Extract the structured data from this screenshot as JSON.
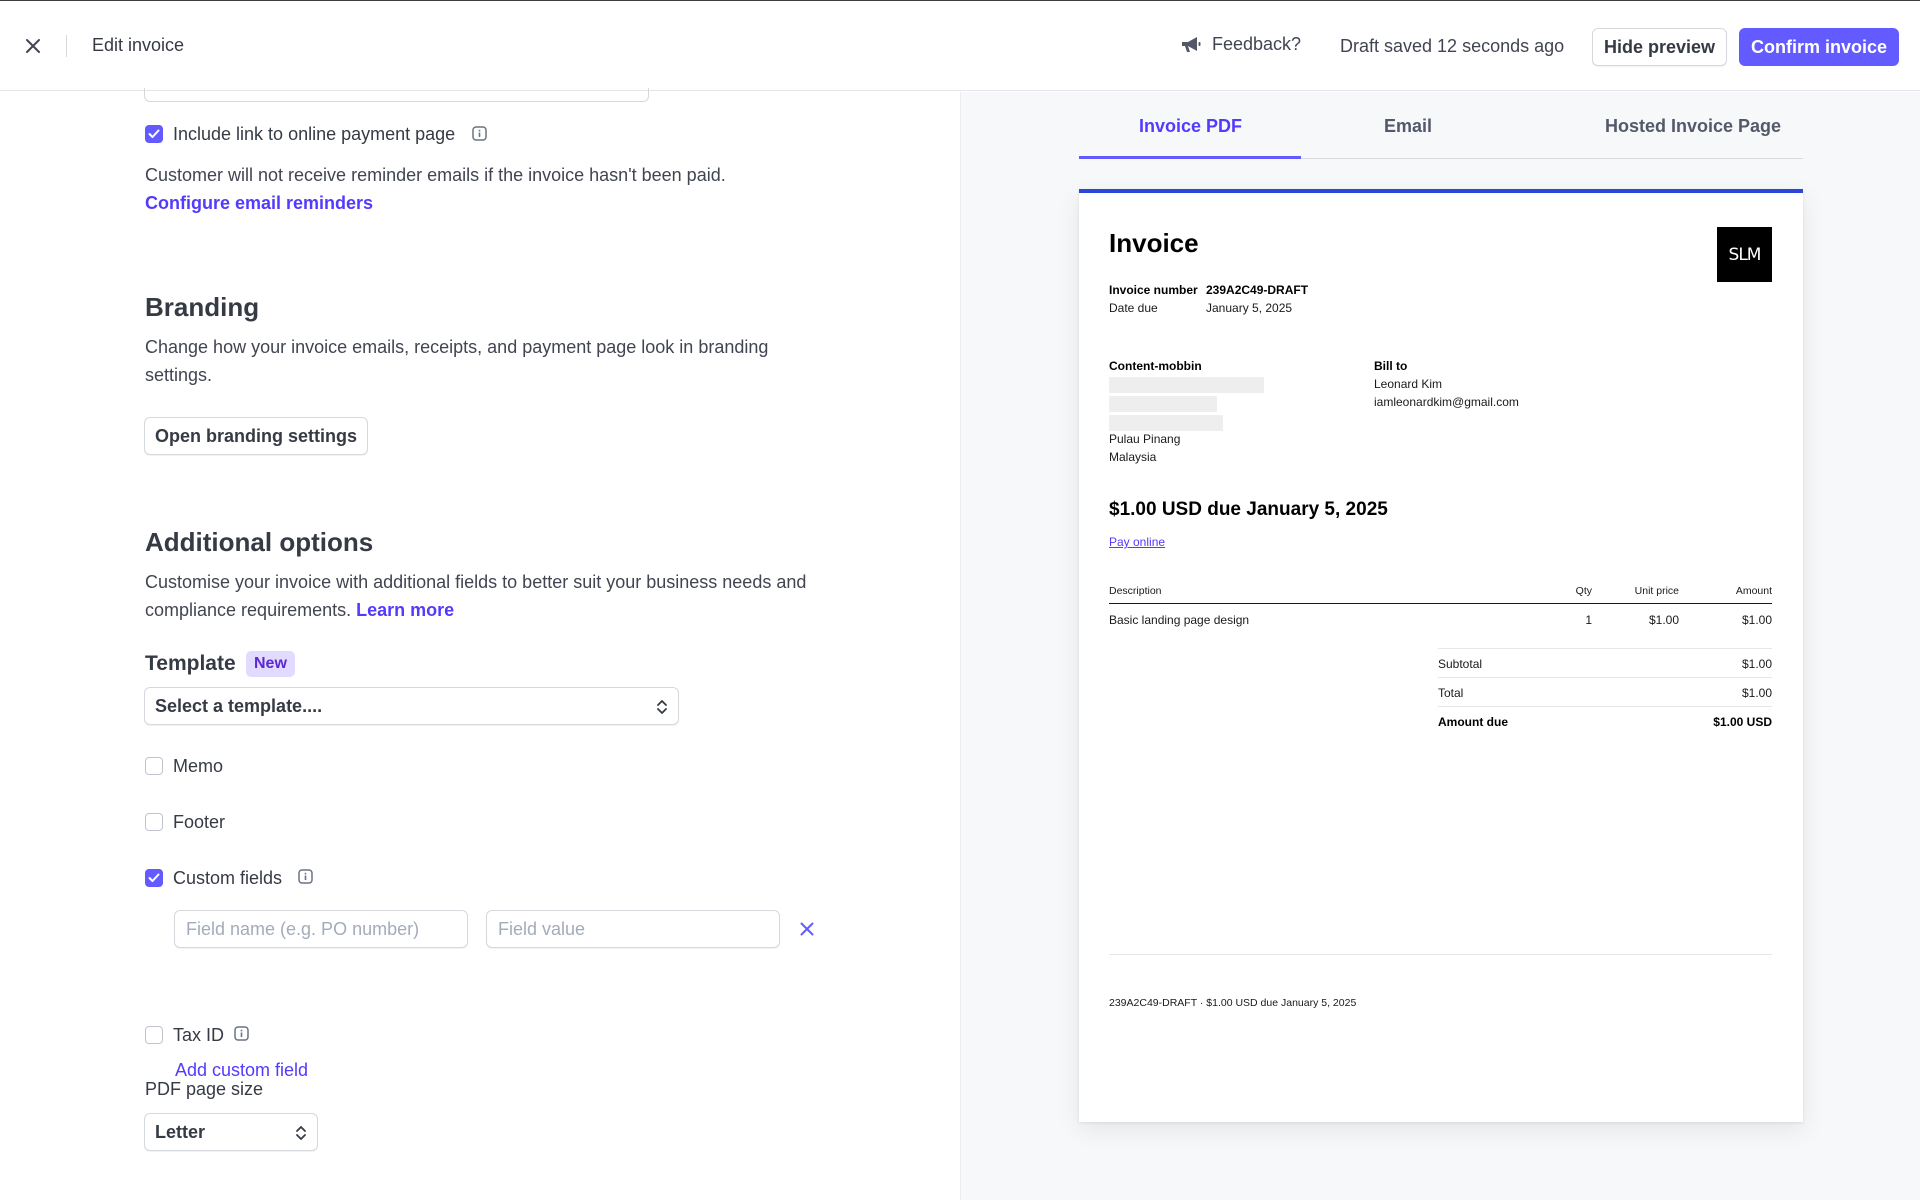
{
  "header": {
    "title": "Edit invoice",
    "feedback_label": "Feedback?",
    "draft_status": "Draft saved 12 seconds ago",
    "hide_preview_label": "Hide preview",
    "confirm_label": "Confirm invoice",
    "accent_color": "#635bff"
  },
  "payment": {
    "include_link_label": "Include link to online payment page",
    "include_link_checked": true,
    "reminder_note": "Customer will not receive reminder emails if the invoice hasn't been paid.",
    "configure_reminders_link": "Configure email reminders"
  },
  "branding": {
    "title": "Branding",
    "description": "Change how your invoice emails, receipts, and payment page look in branding settings.",
    "button_label": "Open branding settings"
  },
  "additional": {
    "title": "Additional options",
    "description": "Customise your invoice with additional fields to better suit your business needs and compliance requirements.",
    "learn_more_link": "Learn more",
    "template_label": "Template",
    "template_badge": "New",
    "template_select_value": "Select a template....",
    "memo_label": "Memo",
    "memo_checked": false,
    "footer_label": "Footer",
    "footer_checked": false,
    "custom_fields_label": "Custom fields",
    "custom_fields_checked": true,
    "field_name_placeholder": "Field name (e.g. PO number)",
    "field_value_placeholder": "Field value",
    "add_custom_field_link": "Add custom field",
    "tax_id_label": "Tax ID",
    "tax_id_checked": false,
    "pdf_page_size_label": "PDF page size",
    "pdf_page_size_value": "Letter"
  },
  "preview": {
    "tabs": [
      {
        "label": "Invoice PDF",
        "active": true
      },
      {
        "label": "Email",
        "active": false
      },
      {
        "label": "Hosted Invoice Page",
        "active": false
      }
    ],
    "invoice": {
      "title": "Invoice",
      "logo_text": "SLM",
      "invoice_number_label": "Invoice number",
      "invoice_number": "239A2C49-DRAFT",
      "date_due_label": "Date due",
      "date_due": "January 5, 2025",
      "from_name": "Content-mobbin",
      "from_city": "Pulau Pinang",
      "from_country": "Malaysia",
      "bill_to_label": "Bill to",
      "bill_to_name": "Leonard Kim",
      "bill_to_email": "iamleonardkim@gmail.com",
      "amount_due_heading": "$1.00 USD due January 5, 2025",
      "pay_online_link": "Pay online",
      "table_headers": {
        "description": "Description",
        "qty": "Qty",
        "unit_price": "Unit price",
        "amount": "Amount"
      },
      "line_items": [
        {
          "description": "Basic landing page design",
          "qty": "1",
          "unit_price": "$1.00",
          "amount": "$1.00"
        }
      ],
      "subtotal_label": "Subtotal",
      "subtotal_value": "$1.00",
      "total_label": "Total",
      "total_value": "$1.00",
      "amount_due_label": "Amount due",
      "amount_due_value": "$1.00 USD",
      "footer_text": "239A2C49-DRAFT · $1.00 USD due January 5, 2025"
    }
  }
}
